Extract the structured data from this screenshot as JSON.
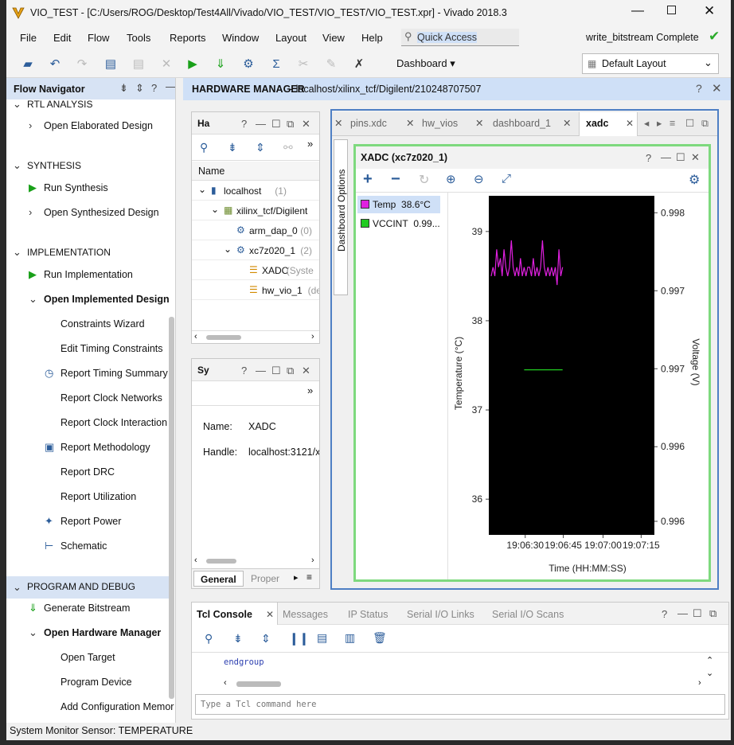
{
  "window": {
    "title": "VIO_TEST - [C:/Users/ROG/Desktop/Test4All/Vivado/VIO_TEST/VIO_TEST/VIO_TEST.xpr] - Vivado 2018.3"
  },
  "menu": [
    "File",
    "Edit",
    "Flow",
    "Tools",
    "Reports",
    "Window",
    "Layout",
    "View",
    "Help"
  ],
  "quick_access": "Quick Access",
  "status_complete": "write_bitstream Complete",
  "toolbar": {
    "dashboard": "Dashboard",
    "layout": "Default Layout"
  },
  "flow_navigator": {
    "title": "Flow Navigator",
    "items": [
      {
        "label": "RTL ANALYSIS",
        "kind": "section"
      },
      {
        "label": "Open Elaborated Design",
        "kind": "expand"
      },
      {
        "label": "SYNTHESIS",
        "kind": "section"
      },
      {
        "label": "Run Synthesis",
        "kind": "run"
      },
      {
        "label": "Open Synthesized Design",
        "kind": "expand"
      },
      {
        "label": "IMPLEMENTATION",
        "kind": "section"
      },
      {
        "label": "Run Implementation",
        "kind": "run"
      },
      {
        "label": "Open Implemented Design",
        "kind": "expanded"
      },
      {
        "label": "Constraints Wizard",
        "kind": "sub"
      },
      {
        "label": "Edit Timing Constraints",
        "kind": "sub"
      },
      {
        "label": "Report Timing Summary",
        "kind": "subicon",
        "icon": "clock-icon"
      },
      {
        "label": "Report Clock Networks",
        "kind": "sub"
      },
      {
        "label": "Report Clock Interaction",
        "kind": "sub"
      },
      {
        "label": "Report Methodology",
        "kind": "subicon",
        "icon": "clipboard-icon"
      },
      {
        "label": "Report DRC",
        "kind": "sub"
      },
      {
        "label": "Report Utilization",
        "kind": "sub"
      },
      {
        "label": "Report Power",
        "kind": "subicon",
        "icon": "power-icon"
      },
      {
        "label": "Schematic",
        "kind": "subicon",
        "icon": "schematic-icon"
      },
      {
        "label": "PROGRAM AND DEBUG",
        "kind": "section-selected"
      },
      {
        "label": "Generate Bitstream",
        "kind": "run2"
      },
      {
        "label": "Open Hardware Manager",
        "kind": "expanded"
      },
      {
        "label": "Open Target",
        "kind": "sub"
      },
      {
        "label": "Program Device",
        "kind": "sub"
      },
      {
        "label": "Add Configuration Memor",
        "kind": "sub"
      }
    ]
  },
  "hw_manager": {
    "title": "HARDWARE MANAGER",
    "path": "localhost/xilinx_tcf/Digilent/210248707507"
  },
  "hardware_panel": {
    "title": "Ha",
    "column": "Name",
    "rows": [
      {
        "label": "localhost",
        "suffix": "(1)",
        "indent": 0
      },
      {
        "label": "xilinx_tcf/Digilent",
        "suffix": "",
        "indent": 1
      },
      {
        "label": "arm_dap_0",
        "suffix": "(0)",
        "indent": 2
      },
      {
        "label": "xc7z020_1",
        "suffix": "(2)",
        "indent": 2
      },
      {
        "label": "XADC",
        "suffix": "(Syste",
        "indent": 3
      },
      {
        "label": "hw_vio_1",
        "suffix": "(de",
        "indent": 3
      }
    ]
  },
  "sys_panel": {
    "title": "Sy",
    "name_label": "Name:",
    "name_value": "XADC",
    "handle_label": "Handle:",
    "handle_value": "localhost:3121/x",
    "tabs": [
      "General",
      "Proper"
    ]
  },
  "dashboard_tabs": [
    "pins.xdc",
    "hw_vios",
    "dashboard_1",
    "xadc"
  ],
  "dashboard_options": "Dashboard Options",
  "xadc_panel": {
    "title": "XADC (xc7z020_1)"
  },
  "legend": [
    {
      "label": "Temp",
      "value": "38.6°C",
      "color": "#e020e0"
    },
    {
      "label": "VCCINT",
      "value": "0.99...",
      "color": "#22cc22"
    }
  ],
  "chart_data": {
    "type": "line",
    "xlabel": "Time (HH:MM:SS)",
    "ylabel": "Temperature (°C)",
    "y2label": "Voltage (V)",
    "x_ticks": [
      "19:06:30",
      "19:06:45",
      "19:07:00",
      "19:07:15"
    ],
    "y_ticks": [
      "39",
      "38",
      "37",
      "36"
    ],
    "ylim": [
      35.6,
      39.4
    ],
    "y2_ticks": [
      "0.998",
      "0.997",
      "0.997",
      "0.996",
      "0.996"
    ],
    "series": [
      {
        "name": "Temp",
        "color": "#e020e0",
        "x": [
          0,
          1,
          2,
          3,
          4,
          5,
          6,
          7,
          8,
          9,
          10,
          11,
          12,
          13,
          14,
          15,
          16,
          17,
          18,
          19,
          20,
          21,
          22,
          23,
          24,
          25,
          26,
          27,
          28,
          29,
          30,
          31,
          32,
          33,
          34,
          35,
          36,
          37,
          38,
          39
        ],
        "values": [
          38.5,
          38.6,
          38.5,
          38.8,
          38.6,
          38.7,
          38.5,
          38.8,
          38.6,
          38.5,
          38.6,
          38.9,
          38.6,
          38.5,
          38.6,
          38.5,
          38.7,
          38.5,
          38.6,
          38.5,
          38.6,
          38.6,
          38.5,
          38.7,
          38.5,
          38.6,
          38.5,
          38.6,
          38.9,
          38.6,
          38.5,
          38.6,
          38.5,
          38.6,
          38.5,
          38.6,
          38.4,
          38.8,
          38.5,
          38.6
        ]
      },
      {
        "name": "VCCINT",
        "color": "#22cc22",
        "x": [
          18,
          39
        ],
        "values": [
          37.45,
          37.45
        ]
      }
    ]
  },
  "console": {
    "tabs": [
      "Tcl Console",
      "Messages",
      "IP Status",
      "Serial I/O Links",
      "Serial I/O Scans"
    ],
    "line": "endgroup",
    "placeholder": "Type a Tcl command here"
  },
  "status_bar": "System Monitor Sensor: TEMPERATURE"
}
